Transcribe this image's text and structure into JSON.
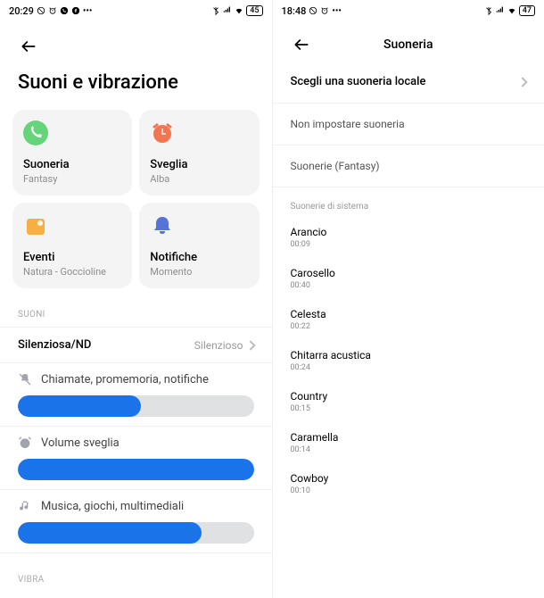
{
  "left": {
    "status": {
      "time": "20:29",
      "battery": "45"
    },
    "title": "Suoni e vibrazione",
    "tiles": [
      {
        "title": "Suoneria",
        "sub": "Fantasy",
        "icon": "phone",
        "bg": "#66d47a",
        "fg": "#fff"
      },
      {
        "title": "Sveglia",
        "sub": "Alba",
        "icon": "alarm",
        "bg": "#ffd9cf",
        "fg": "#f17453"
      },
      {
        "title": "Eventi",
        "sub": "Natura - Goccioline",
        "icon": "calendar",
        "bg": "#ffe5b4",
        "fg": "#f6b041"
      },
      {
        "title": "Notifiche",
        "sub": "Momento",
        "icon": "bell",
        "bg": "#dde7ff",
        "fg": "#5673d9"
      }
    ],
    "section_sounds": "SUONI",
    "silent_row": {
      "title": "Silenziosa/ND",
      "value": "Silenzioso"
    },
    "sliders": [
      {
        "label": "Chiamate, promemoria, notifiche",
        "icon": "bell-off",
        "fill": 52
      },
      {
        "label": "Volume sveglia",
        "icon": "alarm-solid",
        "fill": 100
      },
      {
        "label": "Musica, giochi, multimediali",
        "icon": "music",
        "fill": 78
      }
    ],
    "section_vibra": "VIBRA"
  },
  "right": {
    "status": {
      "time": "18:48",
      "battery": "47"
    },
    "title": "Suoneria",
    "local_row": "Scegli una suoneria locale",
    "none_row": "Non impostare suoneria",
    "current": "Suonerie (Fantasy)",
    "system_header": "Suonerie di sistema",
    "ringtones": [
      {
        "name": "Arancio",
        "dur": "00:09"
      },
      {
        "name": "Carosello",
        "dur": "00:40"
      },
      {
        "name": "Celesta",
        "dur": "00:22"
      },
      {
        "name": "Chitarra acustica",
        "dur": "00:24"
      },
      {
        "name": "Country",
        "dur": "00:15"
      },
      {
        "name": "Caramella",
        "dur": "00:14"
      },
      {
        "name": "Cowboy",
        "dur": "00:10"
      }
    ]
  }
}
